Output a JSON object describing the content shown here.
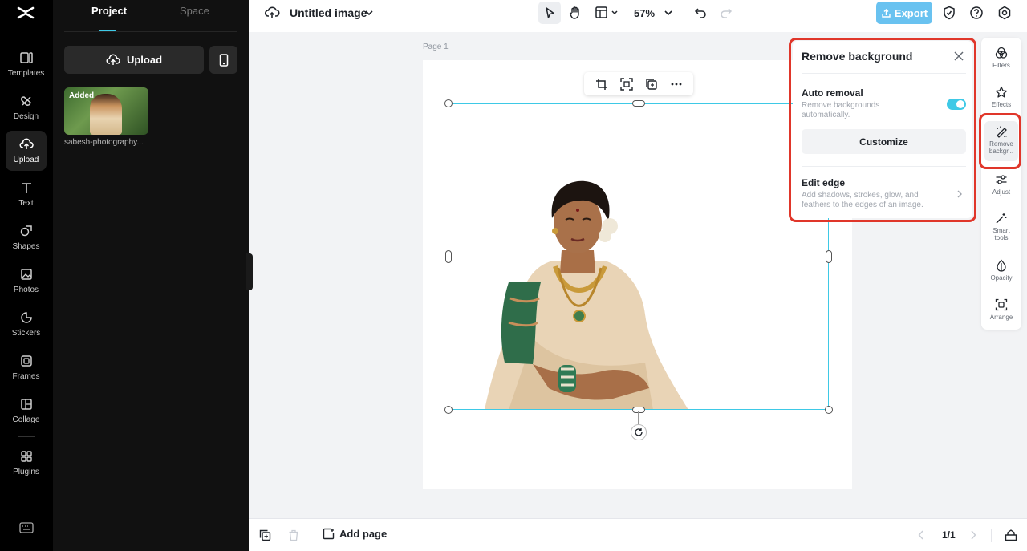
{
  "left_nav": {
    "items": [
      {
        "label": "Templates",
        "icon": "templates-icon"
      },
      {
        "label": "Design",
        "icon": "design-icon"
      },
      {
        "label": "Upload",
        "icon": "upload-icon",
        "active": true
      },
      {
        "label": "Text",
        "icon": "text-icon"
      },
      {
        "label": "Shapes",
        "icon": "shapes-icon"
      },
      {
        "label": "Photos",
        "icon": "photos-icon"
      },
      {
        "label": "Stickers",
        "icon": "stickers-icon"
      },
      {
        "label": "Frames",
        "icon": "frames-icon"
      },
      {
        "label": "Collage",
        "icon": "collage-icon"
      },
      {
        "label": "Plugins",
        "icon": "plugins-icon"
      }
    ]
  },
  "panel": {
    "tabs": [
      "Project",
      "Space"
    ],
    "upload_label": "Upload",
    "asset": {
      "badge": "Added",
      "name": "sabesh-photography..."
    }
  },
  "topbar": {
    "title": "Untitled image",
    "zoom": "57%",
    "export_label": "Export"
  },
  "canvas": {
    "page_label": "Page 1"
  },
  "bottombar": {
    "add_page_label": "Add page",
    "page_indicator": "1/1"
  },
  "popover": {
    "title": "Remove background",
    "auto_title": "Auto removal",
    "auto_desc": "Remove backgrounds automatically.",
    "auto_enabled": true,
    "customize_label": "Customize",
    "edge_title": "Edit edge",
    "edge_desc": "Add shadows, strokes, glow, and feathers to the edges of an image."
  },
  "right_rail": {
    "items": [
      {
        "label": "Filters"
      },
      {
        "label": "Effects"
      },
      {
        "label": "Remove backgr...",
        "active": true
      },
      {
        "label": "Adjust"
      },
      {
        "label": "Smart tools"
      },
      {
        "label": "Opacity"
      },
      {
        "label": "Arrange"
      }
    ]
  },
  "colors": {
    "accent": "#3ec9e6",
    "export": "#69c2f0",
    "highlight": "#e0362a"
  }
}
